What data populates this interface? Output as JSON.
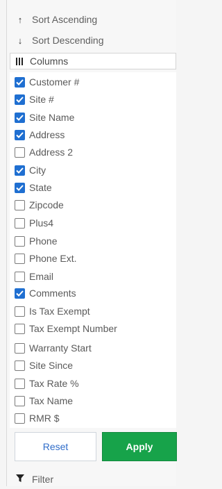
{
  "menu": {
    "sort_ascending": "Sort Ascending",
    "sort_descending": "Sort Descending",
    "columns": "Columns",
    "filter": "Filter"
  },
  "icons": {
    "sort_ascending": "arrow-up-icon",
    "sort_descending": "arrow-down-icon",
    "columns": "columns-icon",
    "filter": "filter-funnel-icon"
  },
  "columns": [
    {
      "label": "Customer #",
      "checked": true
    },
    {
      "label": "Site #",
      "checked": true
    },
    {
      "label": "Site Name",
      "checked": true
    },
    {
      "label": "Address",
      "checked": true
    },
    {
      "label": "Address 2",
      "checked": false
    },
    {
      "label": "City",
      "checked": true
    },
    {
      "label": "State",
      "checked": true
    },
    {
      "label": "Zipcode",
      "checked": false
    },
    {
      "label": "Plus4",
      "checked": false
    },
    {
      "label": "Phone",
      "checked": false
    },
    {
      "label": "Phone Ext.",
      "checked": false
    },
    {
      "label": "Email",
      "checked": false
    },
    {
      "label": "Comments",
      "checked": true
    },
    {
      "label": "Is Tax Exempt",
      "checked": false
    },
    {
      "label": "Tax Exempt Number",
      "checked": false
    },
    {
      "label": "Warranty Start",
      "checked": false
    },
    {
      "label": "Site Since",
      "checked": false
    },
    {
      "label": "Tax Rate %",
      "checked": false
    },
    {
      "label": "Tax Name",
      "checked": false
    },
    {
      "label": "RMR $",
      "checked": false
    }
  ],
  "buttons": {
    "reset": "Reset",
    "apply": "Apply"
  },
  "colors": {
    "accent": "#1f6fd1",
    "apply": "#17a34a",
    "reset_text": "#2f6cc9"
  }
}
